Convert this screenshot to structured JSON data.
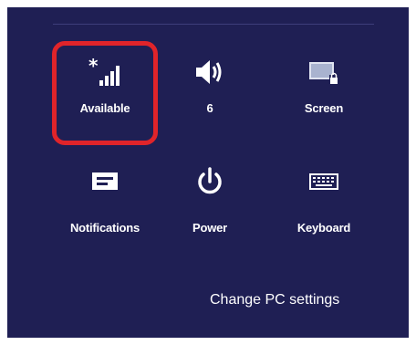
{
  "tiles_row1": [
    {
      "label": "Available",
      "icon": "network-signal-icon",
      "highlighted": true
    },
    {
      "label": "6",
      "icon": "volume-icon"
    },
    {
      "label": "Screen",
      "icon": "screen-icon"
    }
  ],
  "tiles_row2": [
    {
      "label": "Notifications",
      "icon": "notifications-icon"
    },
    {
      "label": "Power",
      "icon": "power-icon"
    },
    {
      "label": "Keyboard",
      "icon": "keyboard-icon"
    }
  ],
  "footer": {
    "change_pc_settings": "Change PC settings"
  },
  "colors": {
    "background": "#1f1f54",
    "highlight": "#e0242a",
    "text": "#ffffff"
  }
}
